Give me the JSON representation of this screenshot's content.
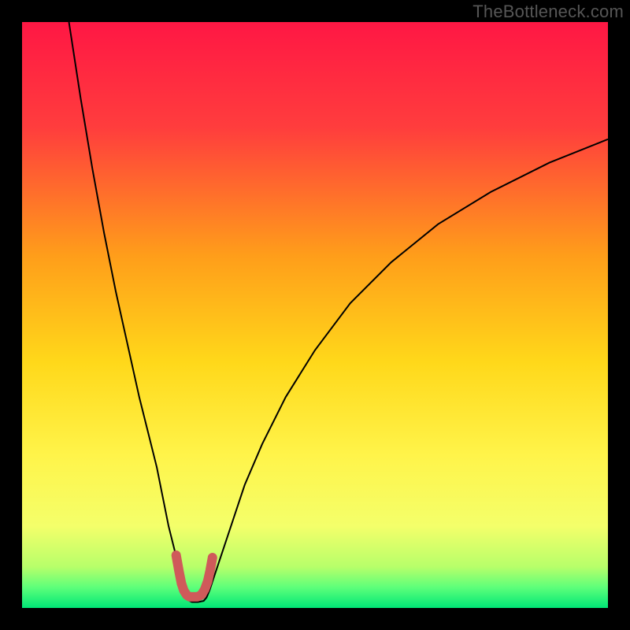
{
  "watermark": "TheBottleneck.com",
  "chart_data": {
    "type": "line",
    "title": "",
    "xlabel": "",
    "ylabel": "",
    "xlim": [
      0,
      100
    ],
    "ylim": [
      0,
      100
    ],
    "grid": false,
    "legend": false,
    "gradient_stops": [
      {
        "pos": 0.0,
        "color": "#ff1744"
      },
      {
        "pos": 0.18,
        "color": "#ff3d3d"
      },
      {
        "pos": 0.4,
        "color": "#ff9e1a"
      },
      {
        "pos": 0.58,
        "color": "#ffd81a"
      },
      {
        "pos": 0.74,
        "color": "#fff44a"
      },
      {
        "pos": 0.86,
        "color": "#f4ff6a"
      },
      {
        "pos": 0.93,
        "color": "#b7ff6a"
      },
      {
        "pos": 0.965,
        "color": "#5dff7a"
      },
      {
        "pos": 1.0,
        "color": "#00e676"
      }
    ],
    "series": [
      {
        "name": "bottleneck-curve",
        "stroke": "#000000",
        "stroke_width": 2,
        "x": [
          8,
          10,
          12,
          14,
          16,
          18,
          20,
          21.5,
          23,
          24,
          25,
          26,
          26.8,
          27.4,
          27.9,
          28.3,
          28.6,
          29,
          30,
          31,
          31.5,
          32,
          33,
          34.5,
          36,
          38,
          41,
          45,
          50,
          56,
          63,
          71,
          80,
          90,
          100
        ],
        "y": [
          100,
          87,
          75,
          64,
          54,
          45,
          36,
          30,
          24,
          19,
          14,
          10,
          6.5,
          4.2,
          2.6,
          1.6,
          1.2,
          1.0,
          1.0,
          1.2,
          1.8,
          3.0,
          6.0,
          10.5,
          15,
          21,
          28,
          36,
          44,
          52,
          59,
          65.5,
          71,
          76,
          80
        ]
      },
      {
        "name": "optimal-marker",
        "stroke": "#cf5a5a",
        "stroke_width": 12,
        "linecap": "round",
        "x": [
          26.3,
          26.8,
          27.2,
          27.6,
          28.1,
          28.6,
          29.2,
          29.9,
          30.6,
          31.2,
          31.7,
          32.1,
          32.5
        ],
        "y": [
          9.0,
          6.2,
          4.2,
          3.0,
          2.2,
          1.9,
          1.9,
          1.9,
          2.2,
          3.2,
          4.6,
          6.4,
          8.6
        ]
      }
    ]
  }
}
